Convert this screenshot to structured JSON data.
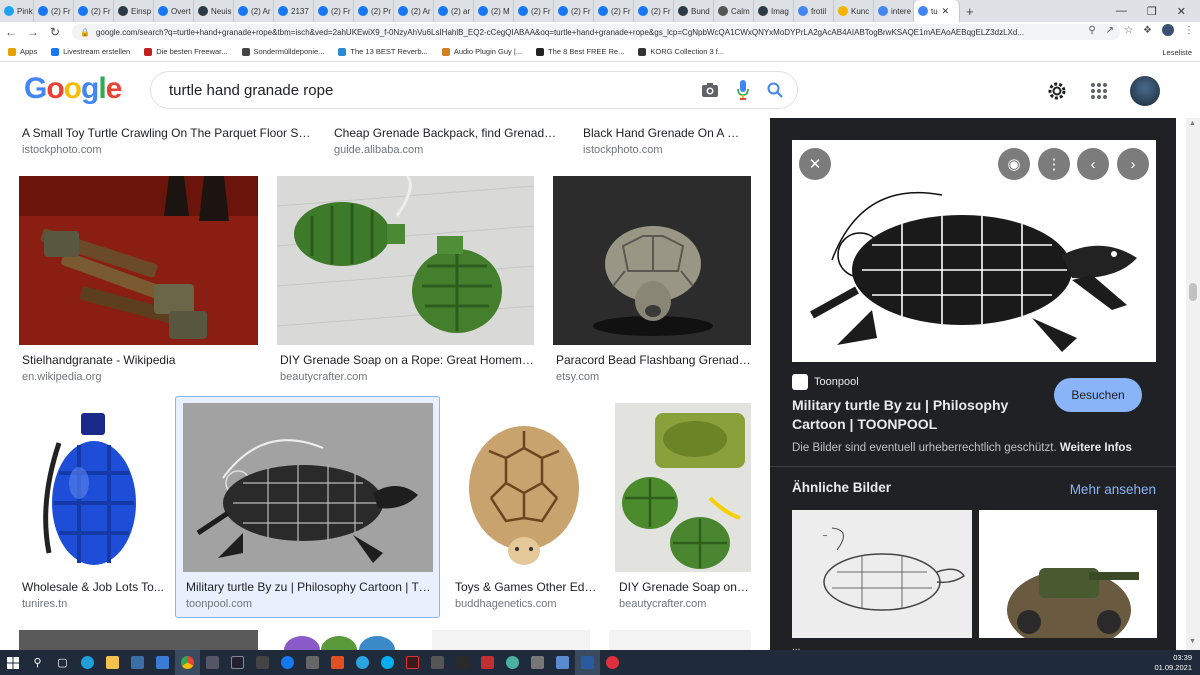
{
  "browser": {
    "tabs": [
      {
        "label": "Pinky",
        "icon": "twitter-icon",
        "color": "#1da1f2"
      },
      {
        "label": "(2) Fr",
        "icon": "facebook-icon",
        "color": "#1877f2"
      },
      {
        "label": "(2) Fr",
        "icon": "facebook-icon",
        "color": "#1877f2"
      },
      {
        "label": "Einsp",
        "icon": "page-icon",
        "color": "#2d3a45"
      },
      {
        "label": "Overt",
        "icon": "facebook-icon",
        "color": "#1877f2"
      },
      {
        "label": "Neuis",
        "icon": "page-icon",
        "color": "#2d3a45"
      },
      {
        "label": "(2) Ar",
        "icon": "facebook-icon",
        "color": "#1877f2"
      },
      {
        "label": "2137",
        "icon": "facebook-icon",
        "color": "#1877f2"
      },
      {
        "label": "(2) Fr",
        "icon": "facebook-icon",
        "color": "#1877f2"
      },
      {
        "label": "(2) Pr",
        "icon": "facebook-icon",
        "color": "#1877f2"
      },
      {
        "label": "(2) Ar",
        "icon": "facebook-icon",
        "color": "#1877f2"
      },
      {
        "label": "(2) ar",
        "icon": "facebook-icon",
        "color": "#1877f2"
      },
      {
        "label": "(2) M",
        "icon": "facebook-icon",
        "color": "#1877f2"
      },
      {
        "label": "(2) Fr",
        "icon": "facebook-icon",
        "color": "#1877f2"
      },
      {
        "label": "(2) Fr",
        "icon": "facebook-icon",
        "color": "#1877f2"
      },
      {
        "label": "(2) Fr",
        "icon": "facebook-icon",
        "color": "#1877f2"
      },
      {
        "label": "(2) Fr",
        "icon": "facebook-icon",
        "color": "#1877f2"
      },
      {
        "label": "Bund",
        "icon": "page-icon",
        "color": "#2d3a45"
      },
      {
        "label": "Calm",
        "icon": "page-icon",
        "color": "#555555"
      },
      {
        "label": "Imag",
        "icon": "page-icon",
        "color": "#2d3a45"
      },
      {
        "label": "frotil",
        "icon": "google-icon",
        "color": "#4285f4"
      },
      {
        "label": "Kunc",
        "icon": "page-icon",
        "color": "#f4b400"
      },
      {
        "label": "intere",
        "icon": "google-icon",
        "color": "#4285f4"
      },
      {
        "label": "tu",
        "icon": "google-icon",
        "color": "#4285f4",
        "active": true
      }
    ],
    "new_tab": "+",
    "url": "google.com/search?q=turtle+hand+granade+rope&tbm=isch&ved=2ahUKEwiX9_f-0NzyAhVu6LsIHahlB_EQ2-cCegQIABAA&oq=turtle+hand+granade+rope&gs_lcp=CgNpbWcQA1CWxQNYxMoDYPrLA2gAcAB4AIABTogBrwKSAQE1mAEAoAEBqgELZ3dzLXd...",
    "bookmarks": [
      {
        "label": "Apps",
        "icon": "apps-icon"
      },
      {
        "label": "Livestream erstellen",
        "icon": "facebook-icon"
      },
      {
        "label": "Die besten Freewar...",
        "icon": "star-icon"
      },
      {
        "label": "Sondermülldeponie...",
        "icon": "w-icon"
      },
      {
        "label": "The 13 BEST Reverb...",
        "icon": "bookmark-icon"
      },
      {
        "label": "Audio Plugin Guy |...",
        "icon": "bookmark-icon"
      },
      {
        "label": "The 8 Best FREE Re...",
        "icon": "bookmark-icon"
      },
      {
        "label": "KORG Collection 3 f...",
        "icon": "bookmark-icon"
      }
    ],
    "reading_list": "Leseliste"
  },
  "google": {
    "logo": [
      "G",
      "o",
      "o",
      "g",
      "l",
      "e"
    ],
    "logo_colors": [
      "#4285f4",
      "#ea4335",
      "#fbbc05",
      "#4285f4",
      "#34a853",
      "#ea4335"
    ],
    "query": "turtle hand granade rope"
  },
  "results": {
    "row0": [
      {
        "title": "A Small Toy Turtle Crawling On The Parquet Floor Sto...",
        "source": "istockphoto.com"
      },
      {
        "title": "Cheap Grenade Backpack, find Grenade B...",
        "source": "guide.alibaba.com"
      },
      {
        "title": "Black Hand Grenade On A Wo...",
        "source": "istockphoto.com"
      }
    ],
    "row1": [
      {
        "title": "Stielhandgranate - Wikipedia",
        "source": "en.wikipedia.org"
      },
      {
        "title": "DIY Grenade Soap on a Rope: Great Homemad...",
        "source": "beautycrafter.com"
      },
      {
        "title": "Paracord Bead Flashbang Grenade ...",
        "source": "etsy.com"
      }
    ],
    "row2": [
      {
        "title": "Wholesale & Job Lots To...",
        "source": "tunires.tn"
      },
      {
        "title": "Military turtle By zu | Philosophy Cartoon | TO...",
        "source": "toonpool.com"
      },
      {
        "title": "Toys & Games Other Edu...",
        "source": "buddhagenetics.com"
      },
      {
        "title": "DIY Grenade Soap on a...",
        "source": "beautycrafter.com"
      }
    ]
  },
  "panel": {
    "source": "Toonpool",
    "title": "Military turtle By zu | Philosophy Cartoon | TOONPOOL",
    "visit_label": "Besuchen",
    "copyright": "Die Bilder sind eventuell urheberrechtlich geschützt.",
    "more_info": "Weitere Infos",
    "similar_heading": "Ähnliche Bilder",
    "see_more": "Mehr ansehen",
    "similar_caption": "...",
    "colors": {
      "background": "#202124",
      "accent": "#8ab4f8"
    }
  },
  "taskbar": {
    "time": "03:39",
    "date": "01.09.2021"
  }
}
